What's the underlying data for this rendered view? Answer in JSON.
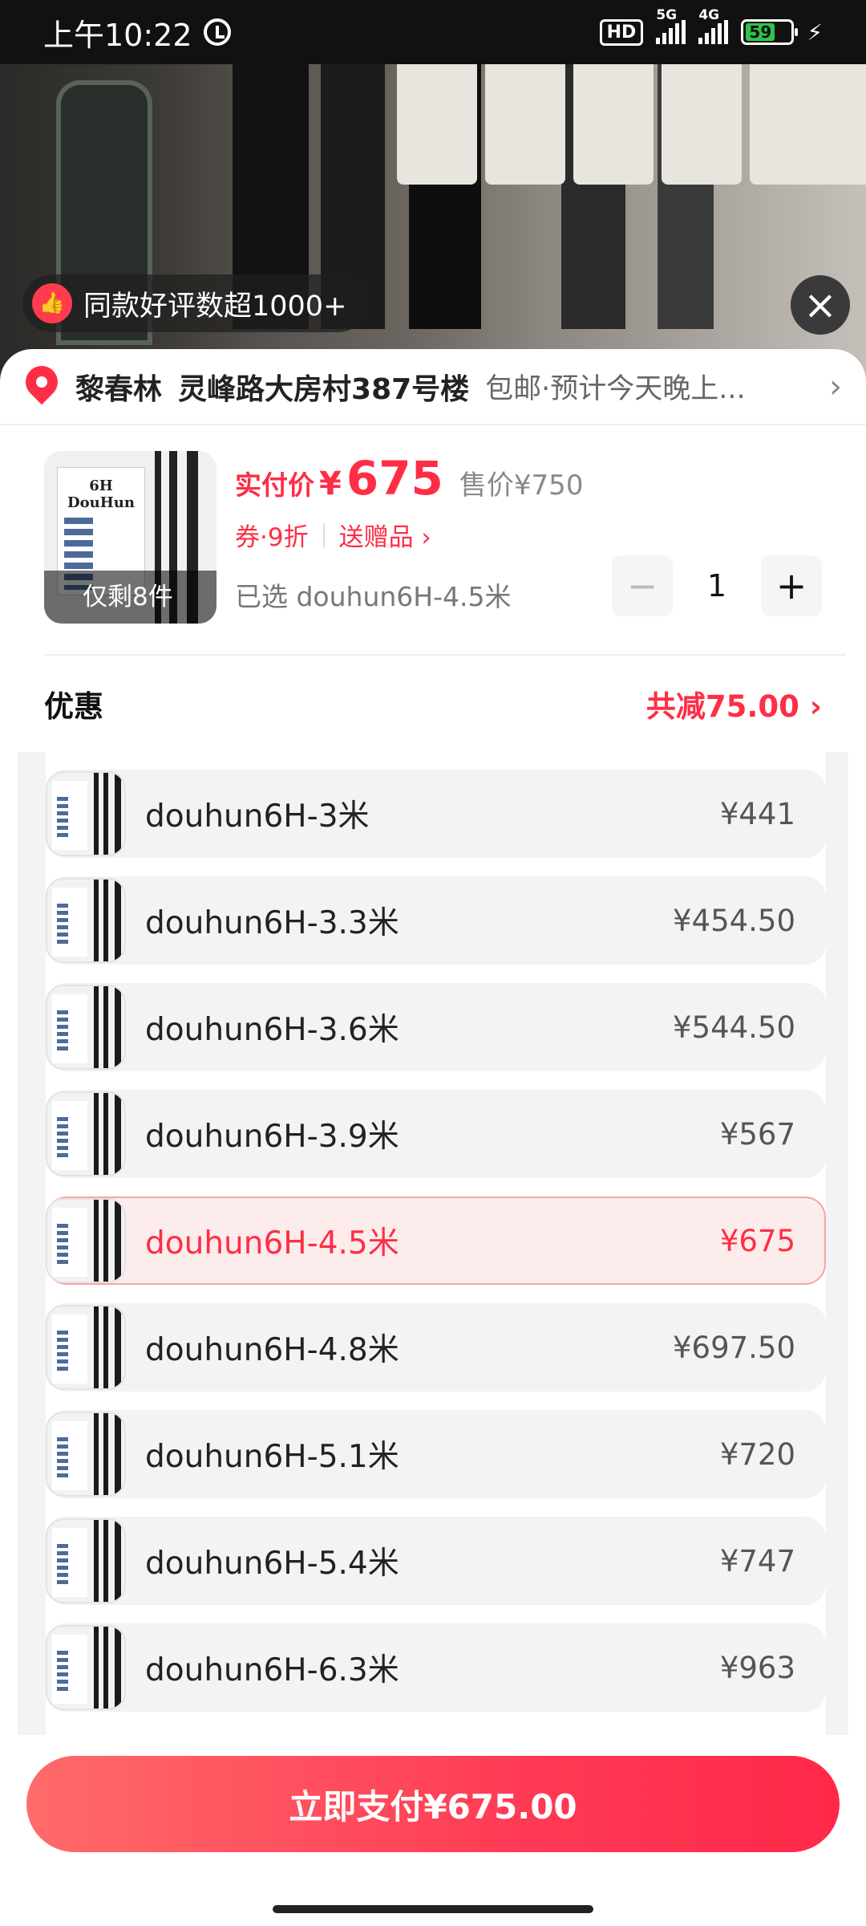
{
  "status_bar": {
    "time": "上午10:22",
    "hd": "HD",
    "net1": "5G",
    "net2": "4G",
    "battery": "59"
  },
  "hero": {
    "review_badge": "同款好评数超1000+",
    "colors": {
      "badge_icon": "#ff3b4f"
    }
  },
  "address": {
    "name": "黎春林",
    "line": "灵峰路大房村387号楼",
    "note": "包邮·预计今天晚上..."
  },
  "product": {
    "stock_badge": "仅剩8件",
    "price_label": "实付价",
    "currency": "¥",
    "price": "675",
    "original_price": "售价¥750",
    "coupon": "券·9折",
    "gift": "送赠品 ›",
    "selected": "已选 douhun6H-4.5米",
    "quantity": "1",
    "minus_label": "−",
    "plus_label": "+"
  },
  "discount": {
    "label": "优惠",
    "value": "共减75.00 ›"
  },
  "sku_list": [
    {
      "name": "douhun6H-3米",
      "price": "¥441",
      "selected": false
    },
    {
      "name": "douhun6H-3.3米",
      "price": "¥454.50",
      "selected": false
    },
    {
      "name": "douhun6H-3.6米",
      "price": "¥544.50",
      "selected": false
    },
    {
      "name": "douhun6H-3.9米",
      "price": "¥567",
      "selected": false
    },
    {
      "name": "douhun6H-4.5米",
      "price": "¥675",
      "selected": true
    },
    {
      "name": "douhun6H-4.8米",
      "price": "¥697.50",
      "selected": false
    },
    {
      "name": "douhun6H-5.1米",
      "price": "¥720",
      "selected": false
    },
    {
      "name": "douhun6H-5.4米",
      "price": "¥747",
      "selected": false
    },
    {
      "name": "douhun6H-6.3米",
      "price": "¥963",
      "selected": false
    }
  ],
  "footer": {
    "pay_button": "立即支付¥675.00"
  },
  "colors": {
    "accent": "#ff2d45",
    "selected_bg": "#fdecec"
  }
}
